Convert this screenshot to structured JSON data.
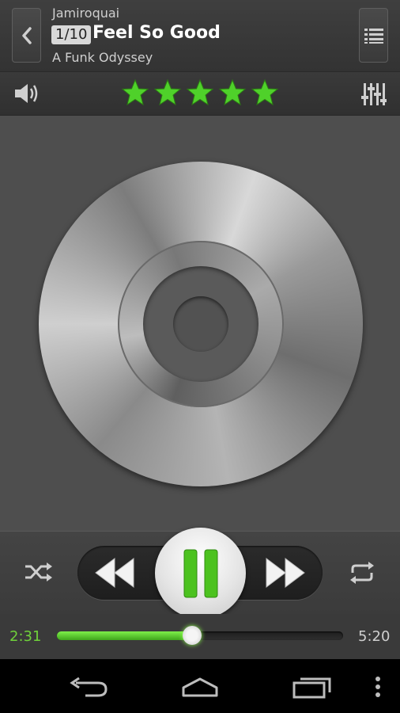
{
  "header": {
    "artist": "Jamiroquai",
    "track_position": "1/10",
    "title": "Feel So Good",
    "album": "A Funk Odyssey"
  },
  "rating": {
    "stars": 5,
    "max": 5,
    "color": "#4fd12a"
  },
  "player": {
    "elapsed": "2:31",
    "duration": "5:20",
    "progress_fraction": 0.472,
    "state": "playing",
    "accent": "#6fd13a"
  },
  "icons": {
    "back": "chevron-left-icon",
    "playlist": "list-icon",
    "volume": "speaker-icon",
    "equalizer": "sliders-icon",
    "shuffle": "shuffle-icon",
    "repeat": "repeat-icon",
    "rewind": "rewind-icon",
    "fast_forward": "fast-forward-icon",
    "pause": "pause-icon",
    "nav_back": "nav-back-icon",
    "nav_home": "nav-home-icon",
    "nav_recent": "nav-recent-apps-icon",
    "nav_menu": "nav-menu-icon"
  }
}
